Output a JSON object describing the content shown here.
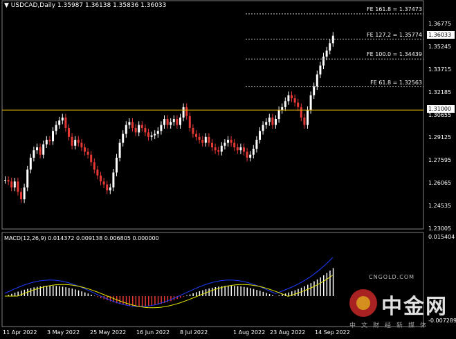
{
  "header": {
    "symbol_title": "USDCAD,Daily",
    "ohlc": "1.35987 1.36138 1.35836 1.36033"
  },
  "price_axis": {
    "ticks": [
      "1.36775",
      "1.35245",
      "1.33715",
      "1.32185",
      "1.30655",
      "1.29125",
      "1.27595",
      "1.26065",
      "1.24535",
      "1.23005"
    ],
    "last_price": "1.36033",
    "level_price": "1.31000"
  },
  "fib_levels": [
    {
      "label": "FE 161.8 = 1.37473",
      "price": 1.37473
    },
    {
      "label": "FE 127.2 = 1.35774",
      "price": 1.35774
    },
    {
      "label": "FE 100.0 = 1.34439",
      "price": 1.34439
    },
    {
      "label": "FE 61.8 = 1.32563",
      "price": 1.32563
    }
  ],
  "horizontal_level": {
    "price": 1.31,
    "color": "#e6b800"
  },
  "macd": {
    "title": "MACD(12,26,9) 0.014372 0.009138 0.006805 0.000000",
    "ticks": {
      "top": "0.015404",
      "bottom": "-0.007289"
    }
  },
  "date_axis": [
    "11 Apr 2022",
    "3 May 2022",
    "25 May 2022",
    "16 Jun 2022",
    "8 Jul 2022",
    "1 Aug 2022",
    "23 Aug 2022",
    "14 Sep 2022"
  ],
  "watermark": {
    "brand": "中金网",
    "url": "CNGOLD.COM",
    "slogan": "中文财经新媒体"
  },
  "colors": {
    "bull": "#ffffff",
    "bear": "#e53935",
    "signal": "#e6e600",
    "macd_line": "#1e3cff",
    "grid_border": "#7f7f7f"
  }
}
